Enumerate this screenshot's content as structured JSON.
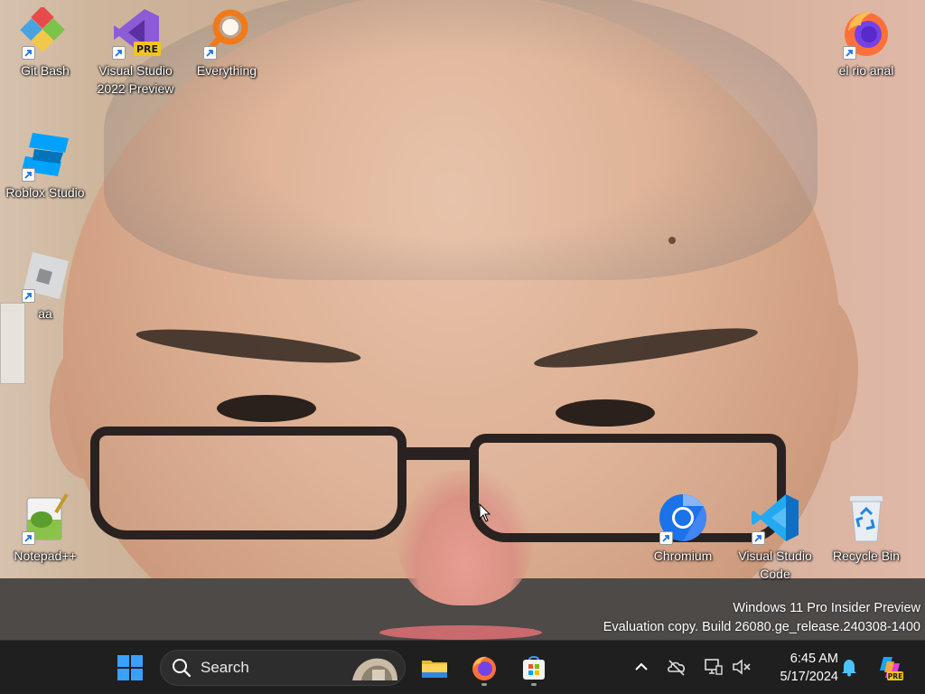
{
  "desktop": {
    "icons": [
      {
        "label": "Git Bash",
        "icon": "git-bash-icon"
      },
      {
        "label": "Visual Studio 2022 Preview",
        "icon": "visual-studio-preview-icon",
        "badge": "PRE"
      },
      {
        "label": "Everything",
        "icon": "everything-search-icon"
      },
      {
        "label": "el rio anal",
        "icon": "firefox-icon"
      },
      {
        "label": "Roblox Studio",
        "icon": "roblox-studio-icon"
      },
      {
        "label": "aa",
        "icon": "roblox-icon"
      },
      {
        "label": "Notepad++",
        "icon": "notepad-plus-plus-icon"
      },
      {
        "label": "Chromium",
        "icon": "chromium-icon"
      },
      {
        "label": "Visual Studio Code",
        "icon": "vscode-icon"
      },
      {
        "label": "Recycle Bin",
        "icon": "recycle-bin-icon"
      }
    ]
  },
  "watermark": {
    "line1": "Windows 11 Pro Insider Preview",
    "line2": "Evaluation copy. Build 26080.ge_release.240308-1400"
  },
  "taskbar": {
    "search_label": "Search",
    "pinned": [
      {
        "name": "start",
        "icon": "windows-start-icon"
      },
      {
        "name": "file-explorer",
        "icon": "folder-icon"
      },
      {
        "name": "firefox",
        "icon": "firefox-icon",
        "running": true
      },
      {
        "name": "microsoft-store",
        "icon": "store-icon",
        "running": true
      }
    ],
    "tray": [
      "chevron-up-icon",
      "onedrive-offline-icon",
      "network-icon",
      "volume-muted-icon"
    ],
    "clock": {
      "time": "6:45 AM",
      "date": "5/17/2024"
    },
    "copilot_badge": "PRE"
  },
  "colors": {
    "taskbar_bg": "#1f1f1f",
    "accent_blue": "#0078d4"
  }
}
